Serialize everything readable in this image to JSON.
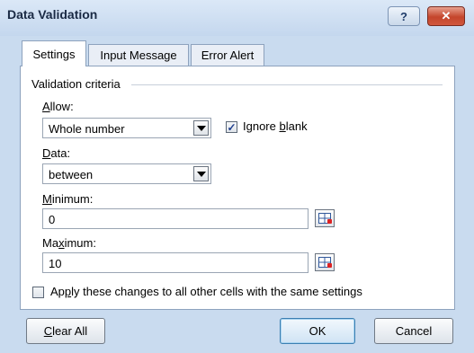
{
  "window": {
    "title": "Data Validation"
  },
  "titlebar": {
    "help_label": "?",
    "close_label": "✕"
  },
  "tabs": [
    {
      "label": "Settings",
      "active": true
    },
    {
      "label": "Input Message",
      "active": false
    },
    {
      "label": "Error Alert",
      "active": false
    }
  ],
  "settings": {
    "group_label": "Validation criteria",
    "allow": {
      "label_pre": "",
      "label_key": "A",
      "label_post": "llow:",
      "value": "Whole number"
    },
    "ignore_blank": {
      "label_pre": "Ignore ",
      "label_key": "b",
      "label_post": "lank",
      "checked": true
    },
    "data": {
      "label_pre": "",
      "label_key": "D",
      "label_post": "ata:",
      "value": "between"
    },
    "minimum": {
      "label_pre": "",
      "label_key": "M",
      "label_post": "inimum:",
      "value": "0"
    },
    "maximum": {
      "label_pre": "Ma",
      "label_key": "x",
      "label_post": "imum:",
      "value": "10"
    },
    "apply_all": {
      "label_pre": "Ap",
      "label_key": "p",
      "label_post": "ly these changes to all other cells with the same settings",
      "checked": false
    }
  },
  "buttons": {
    "clear_all": {
      "label_key": "C",
      "label_post": "lear All"
    },
    "ok": "OK",
    "cancel": "Cancel"
  }
}
